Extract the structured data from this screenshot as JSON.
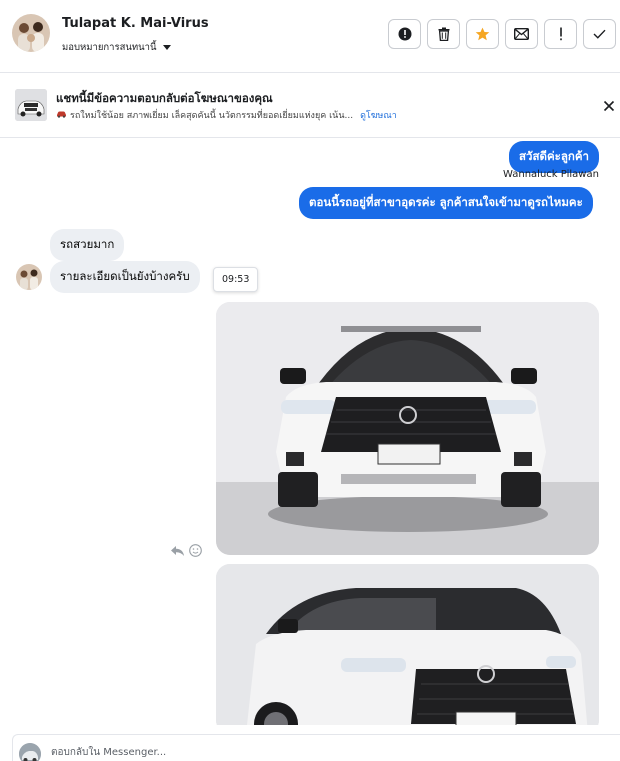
{
  "header": {
    "contact_name": "Tulapat K. Mai-Virus",
    "assign_label": "มอบหมายการสนทนานี้",
    "actions": [
      {
        "name": "report-icon",
        "label": "!"
      },
      {
        "name": "trash-icon",
        "label": ""
      },
      {
        "name": "star-icon",
        "label": ""
      },
      {
        "name": "mail-icon",
        "label": ""
      },
      {
        "name": "exclamation-icon",
        "label": "!"
      },
      {
        "name": "check-icon",
        "label": ""
      }
    ],
    "star_color": "#f5a623"
  },
  "ad_banner": {
    "title": "แชทนี้มีข้อความตอบกลับต่อโฆษณาของคุณ",
    "description": "รถใหม่ใช้น้อย สภาพเยี่ยม เล็คสุดคันนี้ นวัตกรรมที่ยอดเยี่ยมแห่งยุค เน้น...",
    "view_ad_link": "ดูโฆษณา",
    "car_icon": "car-icon"
  },
  "messages": {
    "outgoing_1": "สวัสดีค่ะลูกค้า",
    "outgoing_sender": "Wannaluck Pilawan",
    "outgoing_2": "ตอนนี้รถอยู่ที่สาขาอุดรค่ะ ลูกค้าสนใจเข้ามาดูรถไหมคะ",
    "incoming_1": "รถสวยมาก",
    "incoming_2": "รายละเอียดเป็นยังบ้างครับ",
    "timestamp_tooltip": "09:53"
  },
  "composer": {
    "placeholder": "ตอบกลับใน Messenger..."
  },
  "colors": {
    "accent": "#1a6ce8",
    "incoming_bubble": "#eceff3",
    "link": "#216fdb"
  }
}
